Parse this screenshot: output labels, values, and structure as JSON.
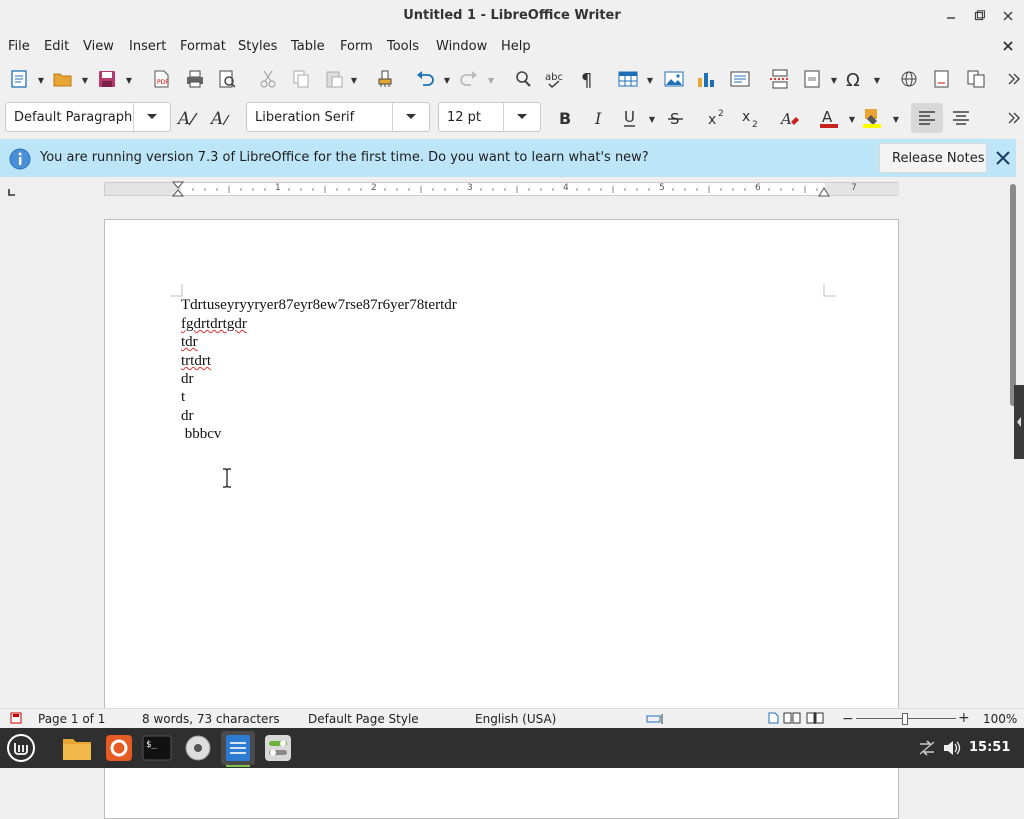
{
  "window": {
    "title": "Untitled 1 - LibreOffice Writer"
  },
  "menu": [
    "File",
    "Edit",
    "View",
    "Insert",
    "Format",
    "Styles",
    "Table",
    "Form",
    "Tools",
    "Window",
    "Help"
  ],
  "toolbar": {
    "paragraph_style": "Default Paragraph",
    "font_name": "Liberation Serif",
    "font_size": "12 pt"
  },
  "infobar": {
    "message": "You are running version 7.3 of LibreOffice for the first time. Do you want to learn what's new?",
    "button": "Release Notes"
  },
  "ruler": {
    "numbers": [
      "1",
      "2",
      "3",
      "4",
      "5",
      "6",
      "7"
    ]
  },
  "document": {
    "lines": [
      "Tdrtuseyryyryer87eyr8ew7rse87r6yer78tertdr",
      "fgdrtdrtgdr",
      "tdr",
      "trtdrt",
      "dr",
      "t",
      "dr",
      " bbbcv"
    ]
  },
  "status": {
    "page": "Page 1 of 1",
    "words": "8 words, 73 characters",
    "page_style": "Default Page Style",
    "language": "English (USA)",
    "zoom": "100%"
  },
  "taskbar": {
    "clock": "15:51"
  },
  "colors": {
    "infobar": "#bde5f8",
    "font_color": "#c9211e",
    "highlight": "#ffff00",
    "taskbar": "#2f2f2f"
  }
}
